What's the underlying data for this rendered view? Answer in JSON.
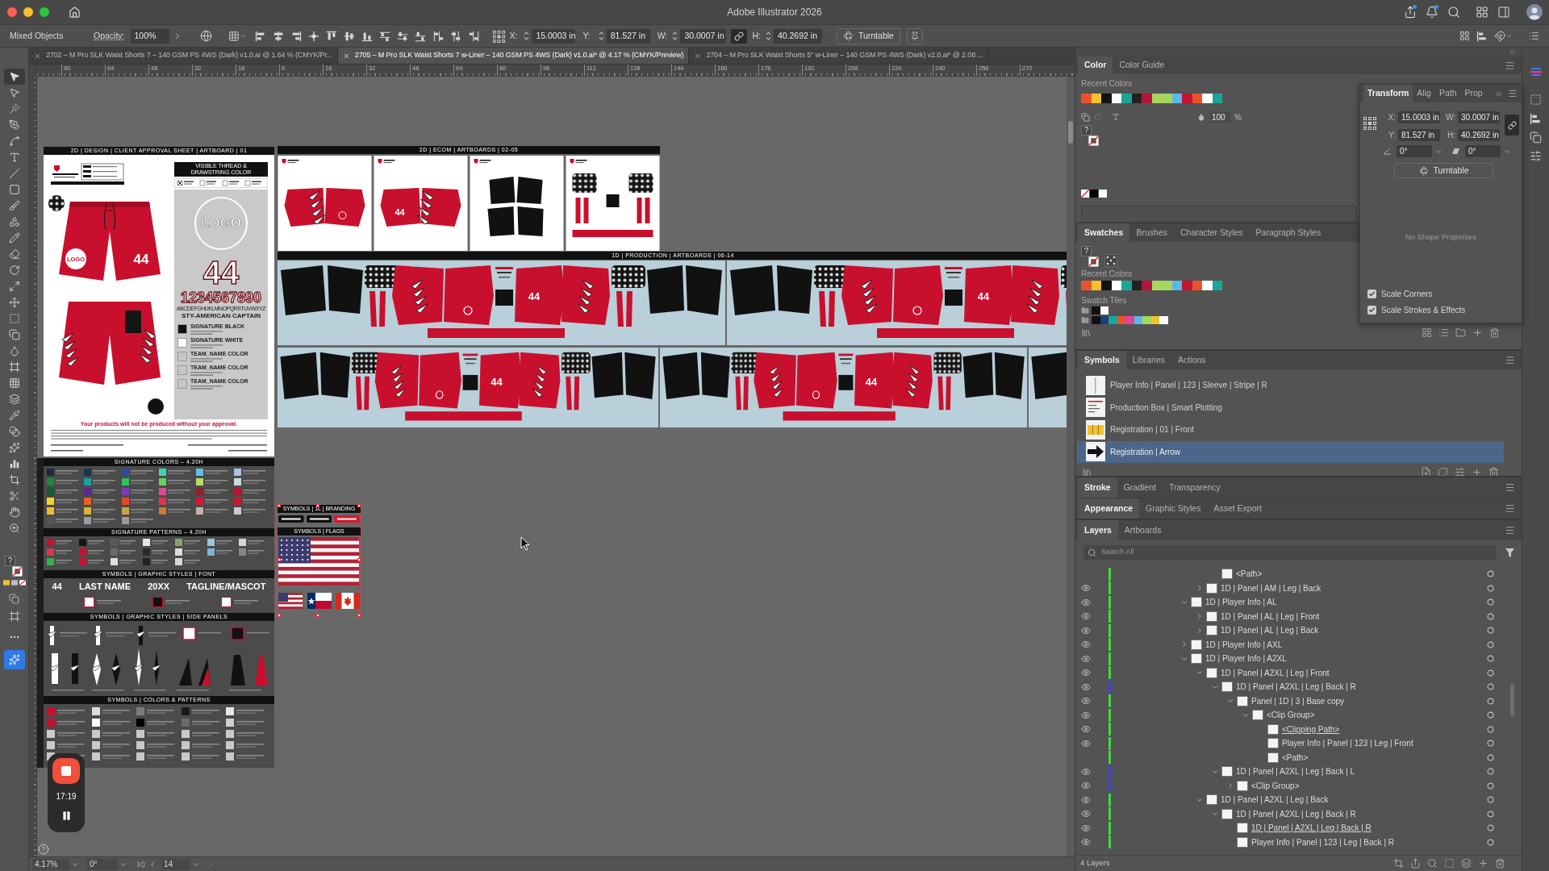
{
  "window": {
    "title": "Adobe Illustrator 2026"
  },
  "control_bar": {
    "selection": "Mixed Objects",
    "opacity_label": "Opacity:",
    "opacity": "100%",
    "x_label": "X:",
    "x": "15.0003 in",
    "y_label": "Y:",
    "y": "81.527 in",
    "w_label": "W:",
    "w": "30.0007 in",
    "h_label": "H:",
    "h": "40.2692 in",
    "constrain": true,
    "turntable": "Turntable"
  },
  "toolbar": {
    "tools": [
      {
        "kind": "selection",
        "selected": true
      },
      {
        "kind": "direct_selection",
        "selected": false
      },
      {
        "kind": "magic_wand",
        "selected": false
      },
      {
        "kind": "pen",
        "selected": false
      },
      {
        "kind": "curvature",
        "selected": false
      },
      {
        "kind": "type",
        "selected": false
      },
      {
        "kind": "line",
        "selected": false
      },
      {
        "kind": "rectangle",
        "selected": false
      },
      {
        "kind": "paintbrush",
        "selected": false
      },
      {
        "kind": "shaper",
        "selected": false
      },
      {
        "kind": "pencil",
        "selected": false
      },
      {
        "kind": "eraser",
        "selected": false
      },
      {
        "kind": "rotate",
        "selected": false
      },
      {
        "kind": "scale",
        "selected": false
      },
      {
        "kind": "width",
        "selected": false
      },
      {
        "kind": "free_transform",
        "selected": false
      },
      {
        "kind": "shape_builder",
        "selected": false
      },
      {
        "kind": "live_paint",
        "selected": false
      },
      {
        "kind": "perspective",
        "selected": false
      },
      {
        "kind": "mesh",
        "selected": false
      },
      {
        "kind": "gradient",
        "selected": false
      },
      {
        "kind": "eyedropper",
        "selected": false
      },
      {
        "kind": "blend",
        "selected": false
      },
      {
        "kind": "symbol_sprayer",
        "selected": false
      },
      {
        "kind": "graph",
        "selected": false
      },
      {
        "kind": "artboard",
        "selected": false
      },
      {
        "kind": "slice",
        "selected": false
      },
      {
        "kind": "hand",
        "selected": false
      },
      {
        "kind": "zoom",
        "selected": false
      }
    ],
    "fill_mark": "?",
    "pin_on": true
  },
  "document_tabs": [
    {
      "title": "2702 – M Pro SLK Waist Shorts 7 – 140 GSM PS 4WS (Dark) v1.0.ai @ 1.64 % (CMYK/Pr...",
      "selected": false
    },
    {
      "title": "2705 – M Pro SLK Waist Shorts 7 w-Liner – 140 GSM PS 4WS (Dark) v1.0.ai* @ 4.17 % (CMYK/Preview)",
      "selected": true
    },
    {
      "title": "2704 – M Pro SLK Waist Shorts 5\" w-Liner – 140 GSM PS 4WS (Dark) v2.0.ai* @ 2.08 ...",
      "selected": false
    }
  ],
  "ruler": [
    "80",
    "64",
    "48",
    "32",
    "16",
    "0",
    "16",
    "32",
    "48",
    "64",
    "80",
    "96",
    "112",
    "128",
    "144",
    "160",
    "176",
    "192",
    "208",
    "224",
    "240",
    "256",
    "272"
  ],
  "canvas": {
    "approval_sheet": {
      "header": "2D | DESIGN | CLIENT APPROVAL SHEET | ARTBOARD | 01",
      "thread_header": "VISIBLE THREAD & DRAWSTRING COLOR",
      "logo": "LOGO",
      "number": "44",
      "digits": "1234567890",
      "alphabet": "ABCDEFGHIJKLMNOPQRSTUVWXYZ",
      "font_name": "STY-AMERICAN CAPTAIN",
      "front_logo": "LOGO",
      "front_number": "44",
      "colors": [
        {
          "label": "SIGNATURE BLACK",
          "color": "#111111"
        },
        {
          "label": "SIGNATURE WHITE",
          "color": "#ffffff"
        },
        {
          "label": "TEAM_NAME COLOR",
          "color": "#c6c6c6"
        },
        {
          "label": "TEAM_NAME COLOR",
          "color": "#c6c6c6"
        },
        {
          "label": "TEAM_NAME COLOR",
          "color": "#c6c6c6"
        }
      ],
      "notice": "Your products will not be produced without your approval."
    },
    "ecom": {
      "header": "2D | ECOM | ARTBOARDS | 02-05",
      "boards": [
        {
          "kind": "front"
        },
        {
          "kind": "back",
          "number": "44"
        },
        {
          "kind": "liner"
        },
        {
          "kind": "pocket"
        }
      ]
    },
    "production": {
      "header": "1D | PRODUCTION | ARTBOARDS | 06-14",
      "rows": [
        [
          {
            "kind": "full",
            "number": "44"
          },
          {
            "kind": "full",
            "number": "44"
          }
        ],
        [
          {
            "kind": "full",
            "number": "44"
          },
          {
            "kind": "full",
            "number": "44"
          },
          {
            "kind": "cut"
          }
        ]
      ]
    },
    "style_guide": {
      "sections": [
        {
          "kind": "colors",
          "title": "SIGNATURE COLORS – 4.20H",
          "swatches": [
            {
              "color": "#1d2a38"
            },
            {
              "color": "#1f3352"
            },
            {
              "color": "#2b4d9a"
            },
            {
              "color": "#3fd3b4"
            },
            {
              "color": "#5cc0e8"
            },
            {
              "color": "#a9c6de"
            },
            {
              "color": "#1c8a3c"
            },
            {
              "color": "#1aa3a3"
            },
            {
              "color": "#2fc062"
            },
            {
              "color": "#62d25e"
            },
            {
              "color": "#b4dc62"
            },
            {
              "color": "#c9dbe6"
            },
            {
              "color": "#145c2c"
            },
            {
              "color": "#5b2a8c"
            },
            {
              "color": "#7d3cb4"
            },
            {
              "color": "#e2498f"
            },
            {
              "color": "#8b2233"
            },
            {
              "color": "#b3172f"
            },
            {
              "color": "#f2d22a"
            },
            {
              "color": "#e8602a"
            },
            {
              "color": "#e44a22"
            },
            {
              "color": "#e3334a"
            },
            {
              "color": "#d21b33"
            },
            {
              "color": "#c61a30"
            },
            {
              "color": "#eac12a"
            },
            {
              "color": "#d9b23a"
            },
            {
              "color": "#c9a34a"
            },
            {
              "color": "#cc7a34"
            },
            {
              "color": "#c4b4ac"
            },
            {
              "color": "#cacaca"
            },
            {
              "color": "#555555"
            },
            {
              "color": "#9c9c9c"
            },
            {
              "color": "#9a9a9a"
            }
          ]
        },
        {
          "kind": "patterns",
          "title": "SIGNATURE PATTERNS – 4.20H",
          "swatches": [
            {
              "color": "#c8102e"
            },
            {
              "color": "#151515"
            },
            {
              "color": "#5a5a5a"
            },
            {
              "color": "#e6e6e6"
            },
            {
              "color": "#8aa070"
            },
            {
              "color": "#9cc4d8"
            },
            {
              "color": "#d4d4d4"
            },
            {
              "color": "#d83a4a"
            },
            {
              "color": "#c8102e"
            },
            {
              "color": "#6a6a6a"
            },
            {
              "color": "#2a2a2a"
            },
            {
              "color": "#dedede"
            },
            {
              "color": "#7fb4d6"
            },
            {
              "color": "#8a8296"
            },
            {
              "color": "#35b04e"
            },
            {
              "color": "#c8102e"
            },
            {
              "color": "#e0e0e0"
            },
            {
              "color": "#222222"
            },
            {
              "color": "#d8d8d8"
            }
          ]
        },
        {
          "kind": "font",
          "title": "SYMBOLS | GRAPHIC STYLES | FONT",
          "samples": [
            "44",
            "LAST NAME",
            "20XX",
            "TAGLINE/MASCOT"
          ],
          "swatches": [
            {
              "color": "#ffffff"
            },
            {
              "color": "#111111"
            },
            {
              "color": "#ffffff"
            }
          ]
        },
        {
          "kind": "side_panels",
          "title": "SYMBOLS | GRAPHIC STYLES | SIDE PANELS"
        },
        {
          "kind": "colors_patterns",
          "title": "SYMBOLS | COLORS & PATTERNS",
          "swatches": [
            {
              "color": "#c8102e"
            },
            {
              "color": "#dcdcdc"
            },
            {
              "color": "#7a7a7a"
            },
            {
              "color": "#1a1a1a"
            },
            {
              "color": "#e6e6e6"
            },
            {
              "color": "#c8102e"
            },
            {
              "color": "#ffffff"
            },
            {
              "color": "#000000"
            },
            {
              "color": "#6a6a6a"
            },
            {
              "color": "#cfcfcf"
            },
            {
              "color": "#c9c9c9"
            },
            {
              "color": "#c9c9c9"
            },
            {
              "color": "#c9c9c9"
            },
            {
              "color": "#c9c9c9"
            },
            {
              "color": "#c9c9c9"
            },
            {
              "color": "#c9c9c9"
            },
            {
              "color": "#c9c9c9"
            },
            {
              "color": "#c9c9c9"
            },
            {
              "color": "#c9c9c9"
            },
            {
              "color": "#c9c9c9"
            },
            {
              "color": "#c9c9c9"
            },
            {
              "color": "#c9c9c9"
            },
            {
              "color": "#c9c9c9"
            },
            {
              "color": "#c9c9c9"
            },
            {
              "color": "#c9c9c9"
            }
          ]
        }
      ]
    },
    "symbols_board": {
      "branding_title": "SYMBOLS | 1L | BRANDING",
      "flags_title": "SYMBOLS | FLAGS",
      "selected": true
    }
  },
  "recorder": {
    "time": "17:19"
  },
  "status_bar": {
    "zoom": "4.17%",
    "rotation": "0°",
    "artboard": "14"
  },
  "color_panel": {
    "tabs": [
      {
        "label": "Color",
        "selected": true
      },
      {
        "label": "Color Guide",
        "selected": false
      }
    ],
    "recent_label": "Recent Colors",
    "recent_colors": [
      {
        "color": "#e8532b"
      },
      {
        "color": "#f2c12e"
      },
      {
        "color": "#121212"
      },
      {
        "color": "#ffffff"
      },
      {
        "color": "#1aa596"
      },
      {
        "color": "#222222"
      },
      {
        "color": "#b3153a"
      },
      {
        "color": "#a6d65e"
      },
      {
        "color": "#a6d65e"
      },
      {
        "color": "#5ab8e6"
      },
      {
        "color": "#c4142f"
      },
      {
        "color": "#e8532b"
      },
      {
        "color": "#ffffff"
      },
      {
        "color": "#1aa596"
      }
    ],
    "fill_mark": "?",
    "opacity": "100",
    "opacity_unit": "%"
  },
  "transform_panel": {
    "tabs": [
      {
        "label": "Transform",
        "selected": true
      },
      {
        "label": "Alig",
        "selected": false
      },
      {
        "label": "Path",
        "selected": false
      },
      {
        "label": "Prop",
        "selected": false
      }
    ],
    "x_label": "X:",
    "x": "15.0003 in",
    "y_label": "Y:",
    "y": "81.527 in",
    "w_label": "W:",
    "w": "30.0007 in",
    "h_label": "H:",
    "h": "40.2692 in",
    "constrain": true,
    "angle": "0°",
    "shear": "0°",
    "turntable": "Turntable",
    "empty_note": "No Shape Properties",
    "options": [
      {
        "label": "Scale Corners",
        "checked": true
      },
      {
        "label": "Scale Strokes & Effects",
        "checked": true
      }
    ]
  },
  "swatches_panel": {
    "tabs": [
      {
        "label": "Swatches",
        "selected": true
      },
      {
        "label": "Brushes",
        "selected": false
      },
      {
        "label": "Character Styles",
        "selected": false
      },
      {
        "label": "Paragraph Styles",
        "selected": false
      }
    ],
    "fill_mark": "?",
    "recent_label": "Recent Colors",
    "recent_colors": [
      {
        "color": "#e8532b"
      },
      {
        "color": "#f2c12e"
      },
      {
        "color": "#121212"
      },
      {
        "color": "#ffffff"
      },
      {
        "color": "#1aa596"
      },
      {
        "color": "#222222"
      },
      {
        "color": "#b3153a"
      },
      {
        "color": "#a6d65e"
      },
      {
        "color": "#a6d65e"
      },
      {
        "color": "#5ab8e6"
      },
      {
        "color": "#c4142f"
      },
      {
        "color": "#e8532b"
      },
      {
        "color": "#ffffff"
      },
      {
        "color": "#1aa596"
      }
    ],
    "tiles_label": "Swatch Tiles",
    "tile_groups": [
      {
        "colors": [
          {
            "color": "#111111"
          },
          {
            "color": "#ffffff"
          }
        ]
      },
      {
        "colors": [
          {
            "color": "#111111"
          },
          {
            "color": "#1d3f7a"
          },
          {
            "color": "#1aa596"
          },
          {
            "color": "#e8532b"
          },
          {
            "color": "#e2449a"
          },
          {
            "color": "#5ab8e6"
          },
          {
            "color": "#a6d65e"
          },
          {
            "color": "#f2c12e"
          },
          {
            "color": "#ffffff"
          }
        ]
      }
    ]
  },
  "symbols_panel": {
    "tabs": [
      {
        "label": "Symbols",
        "selected": true
      },
      {
        "label": "Libraries",
        "selected": false
      },
      {
        "label": "Actions",
        "selected": false
      }
    ],
    "items": [
      {
        "label": "Player Info | Panel | 123 | Sleeve | Stripe | R",
        "kind": "stripe",
        "selected": false
      },
      {
        "label": "Production Box | Smart Plotting",
        "kind": "box",
        "selected": false
      },
      {
        "label": "Registration | 01 | Front",
        "kind": "registration",
        "selected": false
      },
      {
        "label": "Registration | Arrow",
        "kind": "arrow",
        "selected": true
      }
    ]
  },
  "stroke_tabs": [
    {
      "label": "Stroke",
      "selected": true
    },
    {
      "label": "Gradient",
      "selected": false
    },
    {
      "label": "Transparency",
      "selected": false
    }
  ],
  "appearance_tabs": [
    {
      "label": "Appearance",
      "selected": true
    },
    {
      "label": "Graphic Styles",
      "selected": false
    },
    {
      "label": "Asset Export",
      "selected": false
    }
  ],
  "layers_panel": {
    "tabs": [
      {
        "label": "Layers",
        "selected": true
      },
      {
        "label": "Artboards",
        "selected": false
      }
    ],
    "search_placeholder": "Search All",
    "footer": "4 Layers",
    "rows": [
      {
        "children": [
          {
            "children": [
              {
                "label": "<Path>",
                "kind": "path",
                "visible": false,
                "color": "#3ddc3d"
              }
            ]
          },
          {
            "label": "1D | Panel | AM | Leg | Back",
            "kind": "group",
            "expanded": false,
            "visible": true,
            "color": "#3ddc3d"
          }
        ]
      },
      {
        "label": "1D | Player Info | AL",
        "kind": "group",
        "expanded": true,
        "visible": true,
        "color": "#3ddc3d",
        "children": [
          {
            "label": "1D | Panel | AL | Leg | Front",
            "kind": "group",
            "expanded": false,
            "visible": true,
            "color": "#3ddc3d"
          },
          {
            "label": "1D | Panel | AL | Leg | Back",
            "kind": "group",
            "expanded": false,
            "visible": true,
            "color": "#3ddc3d"
          }
        ]
      },
      {
        "label": "1D | Player Info | AXL",
        "kind": "group",
        "expanded": false,
        "visible": true,
        "color": "#3ddc3d"
      },
      {
        "label": "1D | Player Info | A2XL",
        "kind": "group",
        "expanded": true,
        "visible": true,
        "color": "#3ddc3d",
        "children": [
          {
            "label": "1D | Panel | A2XL | Leg | Front",
            "kind": "group",
            "expanded": true,
            "visible": true,
            "color": "#3ddc3d",
            "children": [
              {
                "label": "1D | Panel | A2XL | Leg | Back | R",
                "kind": "group",
                "expanded": true,
                "visible": true,
                "color": "#4040d8",
                "children": [
                  {
                    "label": "Panel | 1D | 3 | Base copy",
                    "kind": "group",
                    "expanded": true,
                    "visible": true,
                    "color": "#3ddc3d",
                    "children": [
                      {
                        "label": "<Clip Group>",
                        "kind": "group",
                        "expanded": true,
                        "visible": true,
                        "color": "#3ddc3d",
                        "children": [
                          {
                            "label": "<Clipping Path>",
                            "kind": "clipping",
                            "visible": true,
                            "color": "#3ddc3d"
                          },
                          {
                            "label": "Player Info | Panel | 123 | Leg | Front",
                            "kind": "path",
                            "visible": true,
                            "color": "#3ddc3d"
                          },
                          {
                            "label": "<Path>",
                            "kind": "path",
                            "visible": false,
                            "color": "#3ddc3d"
                          }
                        ]
                      }
                    ]
                  }
                ]
              },
              {
                "label": "1D | Panel | A2XL | Leg | Back | L",
                "kind": "group",
                "expanded": true,
                "visible": true,
                "color": "#4040d8",
                "children": [
                  {
                    "label": "<Clip Group>",
                    "kind": "group",
                    "expanded": false,
                    "visible": true,
                    "color": "#4040d8"
                  }
                ]
              }
            ]
          },
          {
            "label": "1D | Panel | A2XL | Leg | Back",
            "kind": "group",
            "expanded": true,
            "visible": true,
            "color": "#3ddc3d",
            "children": [
              {
                "label": "1D | Panel | A2XL | Leg | Back | R",
                "kind": "group",
                "expanded": true,
                "visible": true,
                "color": "#3ddc3d",
                "children": [
                  {
                    "label": "1D | Panel | A2XL | Leg | Back | R",
                    "kind": "clipping",
                    "visible": true,
                    "color": "#3ddc3d"
                  },
                  {
                    "label": "Player Info | Panel | 123 | Leg | Back | R",
                    "kind": "path",
                    "visible": true,
                    "color": "#3ddc3d"
                  }
                ]
              }
            ]
          }
        ]
      }
    ]
  }
}
